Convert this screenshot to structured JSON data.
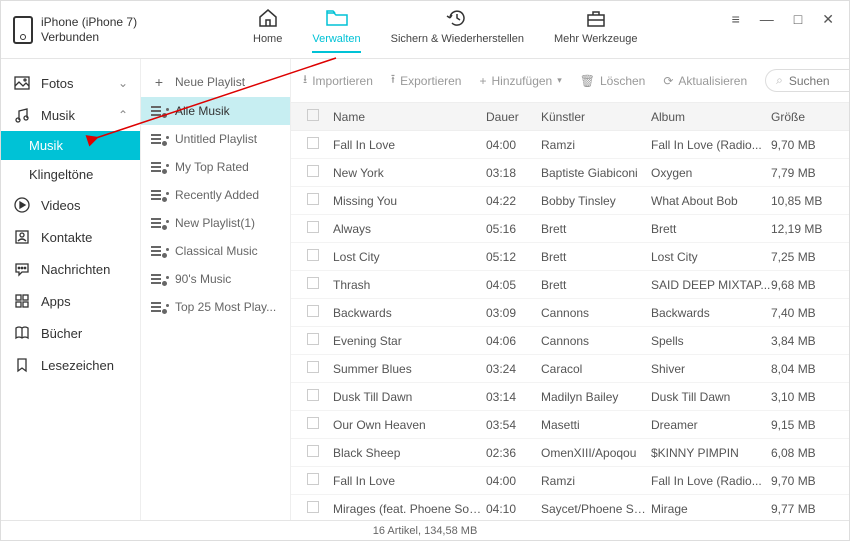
{
  "device": {
    "name": "iPhone (iPhone 7)",
    "status": "Verbunden"
  },
  "nav": {
    "home": "Home",
    "verwalten": "Verwalten",
    "sichern": "Sichern & Wiederherstellen",
    "werkzeuge": "Mehr Werkzeuge"
  },
  "sidebar": {
    "fotos": "Fotos",
    "musik": "Musik",
    "musik_sub": "Musik",
    "klingel": "Klingeltöne",
    "videos": "Videos",
    "kontakte": "Kontakte",
    "nachrichten": "Nachrichten",
    "apps": "Apps",
    "buecher": "Bücher",
    "lesezeichen": "Lesezeichen"
  },
  "playlists": {
    "neue": "Neue Playlist",
    "alle": "Alle Musik",
    "untitled": "Untitled Playlist",
    "mytop": "My Top Rated",
    "recent": "Recently Added",
    "new1": "New Playlist(1)",
    "classical": "Classical Music",
    "nineties": "90's Music",
    "top25": "Top 25 Most Play..."
  },
  "toolbar": {
    "import": "Importieren",
    "export": "Exportieren",
    "add": "Hinzufügen",
    "delete": "Löschen",
    "refresh": "Aktualisieren",
    "search_placeholder": "Suchen"
  },
  "columns": {
    "name": "Name",
    "dauer": "Dauer",
    "kuenstler": "Künstler",
    "album": "Album",
    "groesse": "Größe"
  },
  "tracks": [
    {
      "name": "Fall In Love",
      "dauer": "04:00",
      "artist": "Ramzi",
      "album": "Fall In Love (Radio...",
      "size": "9,70 MB"
    },
    {
      "name": "New York",
      "dauer": "03:18",
      "artist": "Baptiste Giabiconi",
      "album": "Oxygen",
      "size": "7,79 MB"
    },
    {
      "name": "Missing You",
      "dauer": "04:22",
      "artist": "Bobby Tinsley",
      "album": "What About Bob",
      "size": "10,85 MB"
    },
    {
      "name": "Always",
      "dauer": "05:16",
      "artist": "Brett",
      "album": "Brett",
      "size": "12,19 MB"
    },
    {
      "name": "Lost City",
      "dauer": "05:12",
      "artist": "Brett",
      "album": "Lost City",
      "size": "7,25 MB"
    },
    {
      "name": "Thrash",
      "dauer": "04:05",
      "artist": "Brett",
      "album": "SAID DEEP MIXTAP...",
      "size": "9,68 MB"
    },
    {
      "name": "Backwards",
      "dauer": "03:09",
      "artist": "Cannons",
      "album": "Backwards",
      "size": "7,40 MB"
    },
    {
      "name": "Evening Star",
      "dauer": "04:06",
      "artist": "Cannons",
      "album": "Spells",
      "size": "3,84 MB"
    },
    {
      "name": "Summer Blues",
      "dauer": "03:24",
      "artist": "Caracol",
      "album": "Shiver",
      "size": "8,04 MB"
    },
    {
      "name": "Dusk Till Dawn",
      "dauer": "03:14",
      "artist": "Madilyn Bailey",
      "album": "Dusk Till Dawn",
      "size": "3,10 MB"
    },
    {
      "name": "Our Own Heaven",
      "dauer": "03:54",
      "artist": "Masetti",
      "album": "Dreamer",
      "size": "9,15 MB"
    },
    {
      "name": "Black Sheep",
      "dauer": "02:36",
      "artist": "OmenXIII/Apoqou",
      "album": "$KINNY PIMPIN",
      "size": "6,08 MB"
    },
    {
      "name": "Fall In Love",
      "dauer": "04:00",
      "artist": "Ramzi",
      "album": "Fall In Love (Radio...",
      "size": "9,70 MB"
    },
    {
      "name": "Mirages (feat. Phoene Somsavath)",
      "dauer": "04:10",
      "artist": "Saycet/Phoene Som...",
      "album": "Mirage",
      "size": "9,77 MB"
    }
  ],
  "status": "16 Artikel, 134,58 MB"
}
